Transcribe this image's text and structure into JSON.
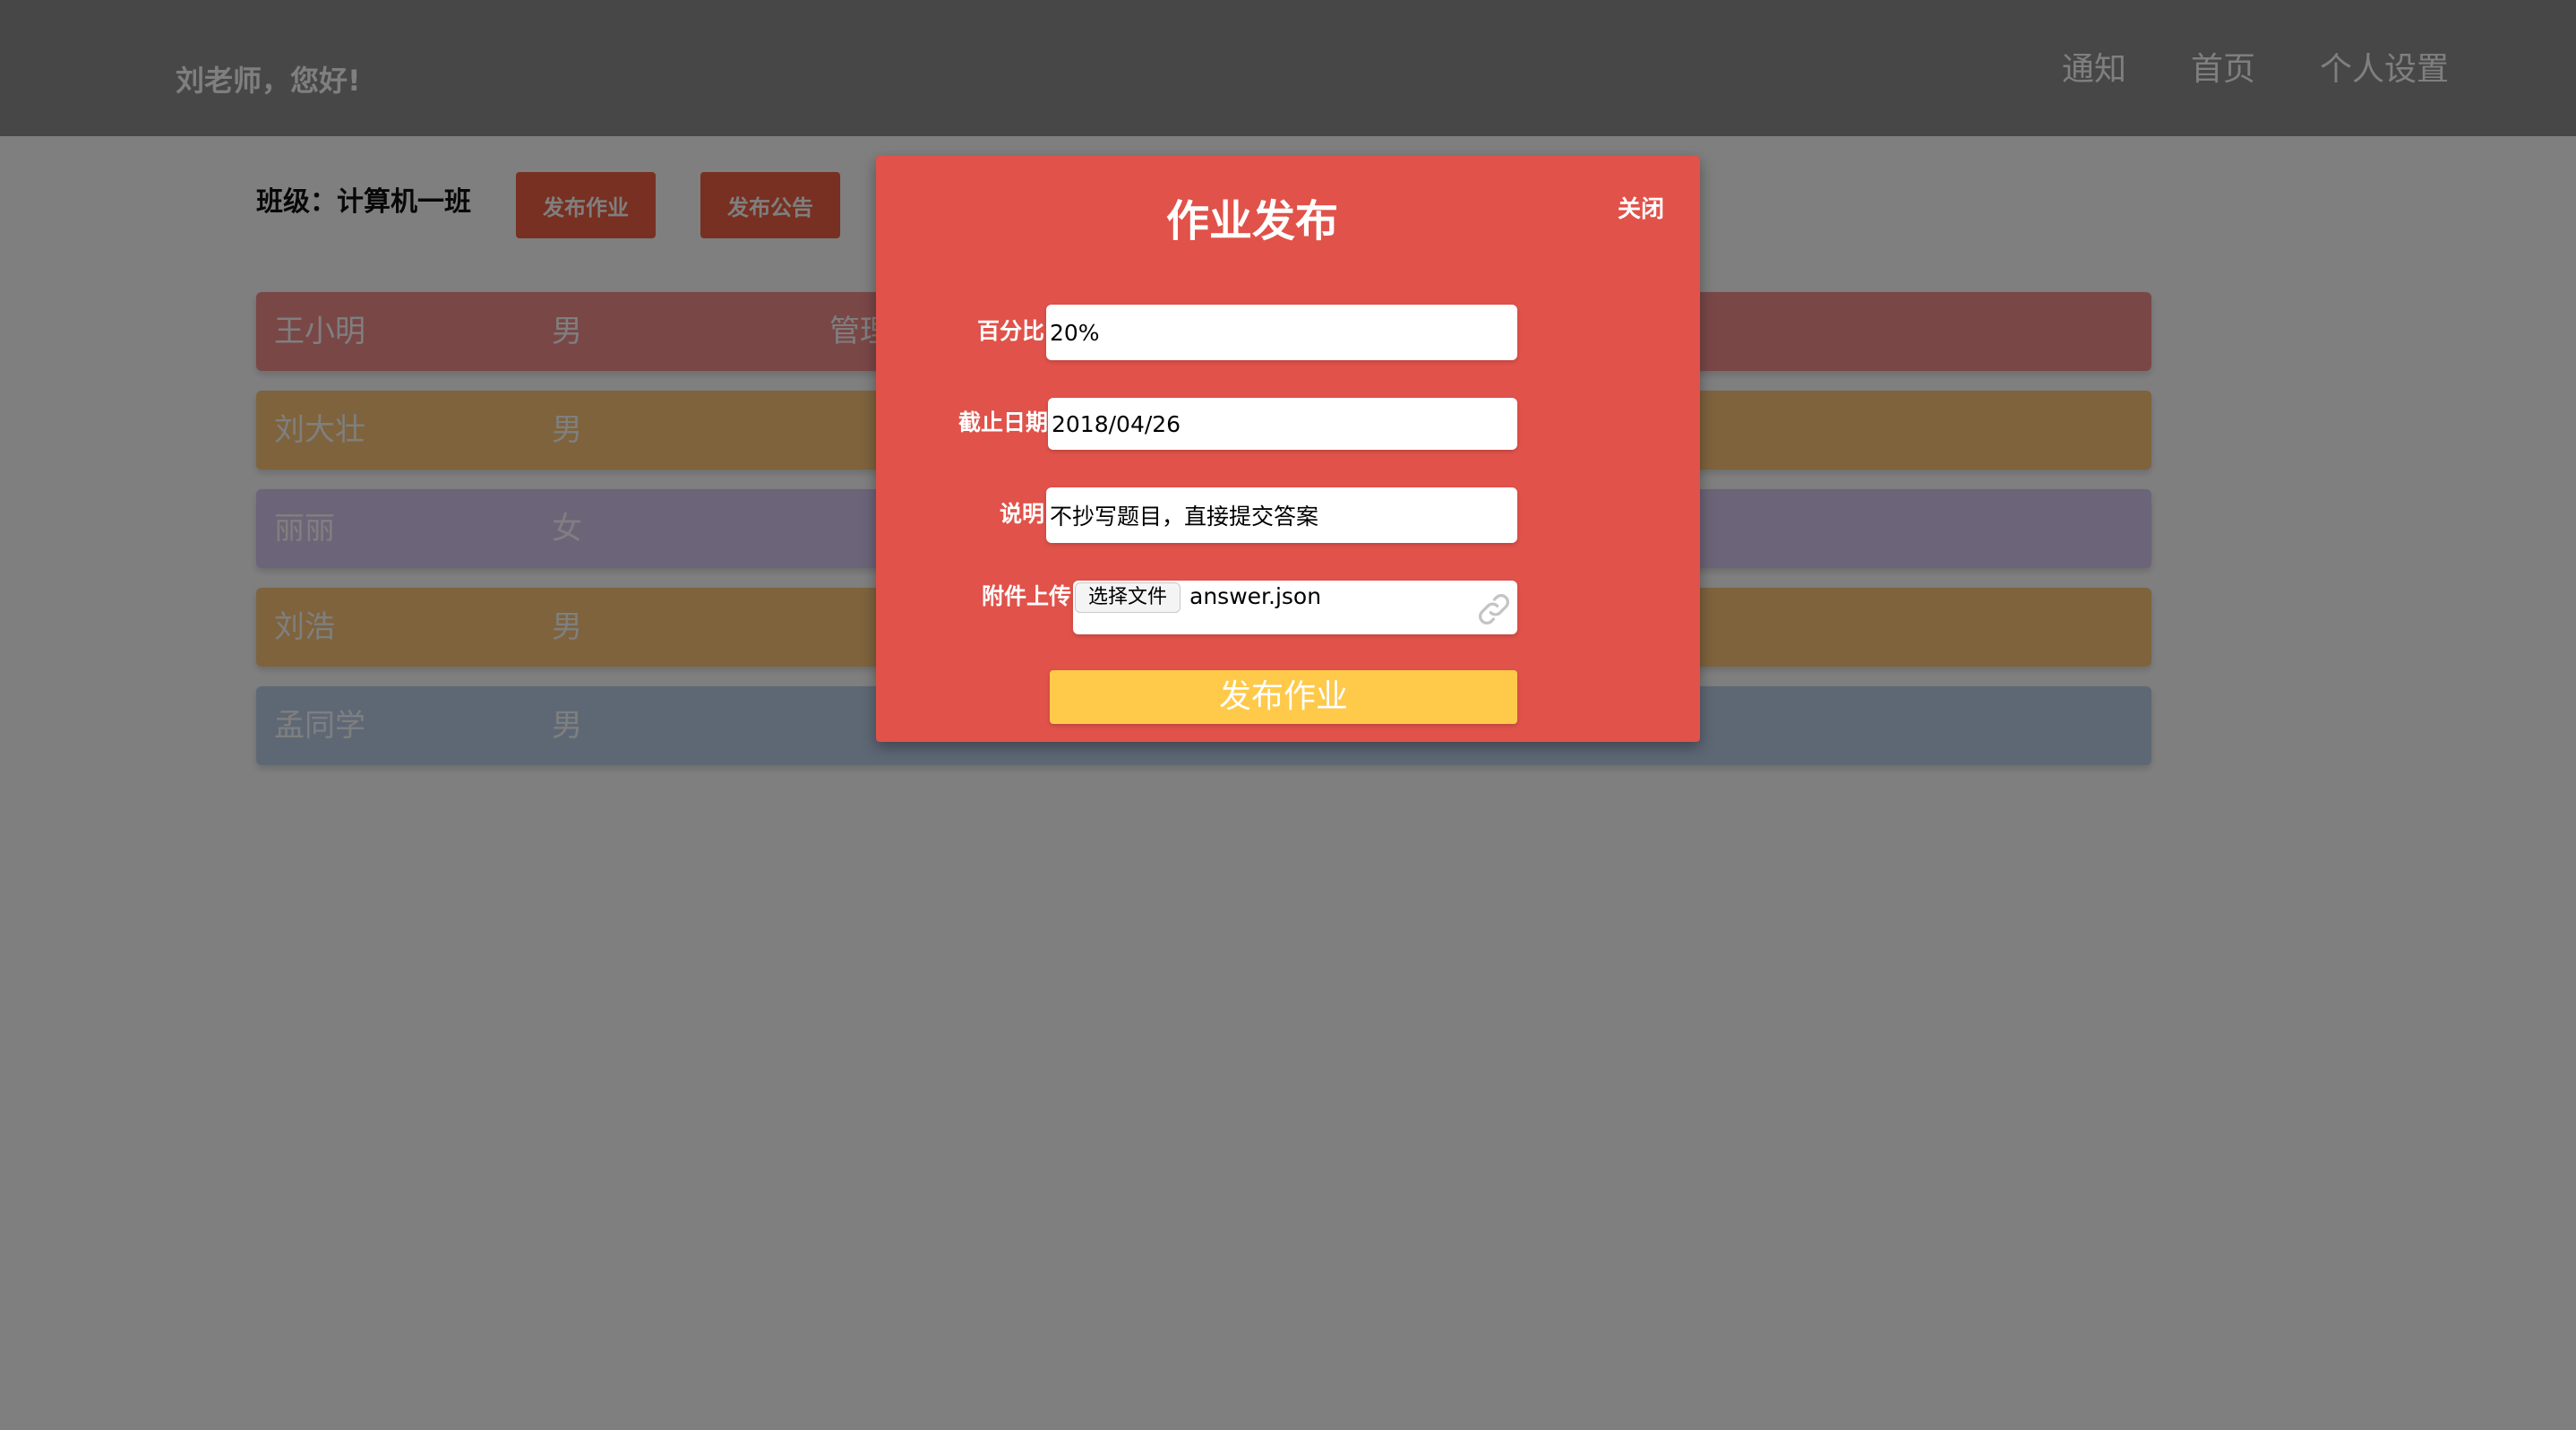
{
  "header": {
    "greeting": "刘老师，您好!",
    "nav": [
      "通知",
      "首页",
      "个人设置"
    ]
  },
  "toolbar": {
    "class_label": "班级：计算机一班",
    "publish_homework": "发布作业",
    "publish_notice": "发布公告"
  },
  "students": [
    {
      "name": "王小明",
      "gender": "男",
      "role": "管理",
      "color": "#f48e8e"
    },
    {
      "name": "刘大壮",
      "gender": "男",
      "role": "",
      "color": "#fdc77a"
    },
    {
      "name": "丽丽",
      "gender": "女",
      "role": "",
      "color": "#d9c8f1"
    },
    {
      "name": "刘浩",
      "gender": "男",
      "role": "",
      "color": "#fdc77a"
    },
    {
      "name": "孟同学",
      "gender": "男",
      "role": "",
      "color": "#bcd0ea"
    }
  ],
  "modal": {
    "title": "作业发布",
    "close": "关闭",
    "fields": {
      "percent_label": "百分比",
      "percent_value": "20%",
      "deadline_label": "截止日期",
      "deadline_value": "2018/04/26",
      "desc_label": "说明",
      "desc_value": "不抄写题目，直接提交答案",
      "attach_label": "附件上传",
      "choose_file": "选择文件",
      "file_name": "answer.json"
    },
    "submit": "发布作业"
  },
  "colors": {
    "modal_bg": "#e0524a",
    "submit_bg": "#ffc94a",
    "tool_button_bg": "#ef6043"
  }
}
